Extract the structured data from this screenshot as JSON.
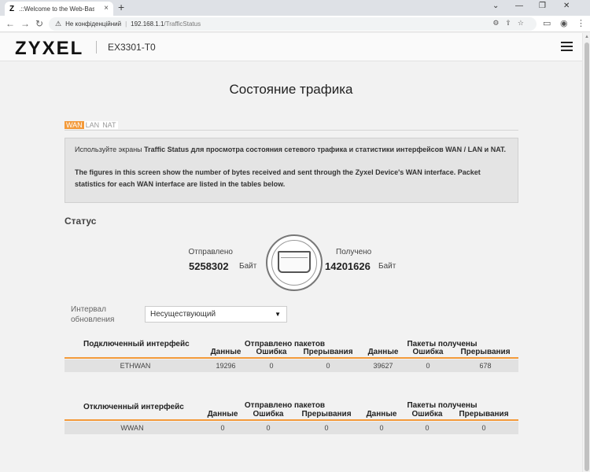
{
  "browser": {
    "tab_favicon": "Z",
    "tab_title": ".::Welcome to the Web-Based Co",
    "tab_close": "×",
    "new_tab": "+",
    "security_label": "Не конфіденційний",
    "url_host": "192.168.1.1",
    "url_path": "/TrafficStatus",
    "win_controls": [
      "⌄",
      "—",
      "❐",
      "✕"
    ]
  },
  "header": {
    "logo": "ZYXEL",
    "model": "EX3301-T0"
  },
  "page": {
    "title": "Состояние трафика",
    "tabs": [
      {
        "label": "WAN",
        "active": true
      },
      {
        "label": "LAN",
        "active": false
      },
      {
        "label": "NAT",
        "active": false
      }
    ],
    "info": {
      "line1_prefix": "Используйте экраны ",
      "line1_bold": "Traffic Status для просмотра состояния сетевого трафика и статистики интерфейсов WAN / LAN и NAT.",
      "line2": "The figures in this screen show the number of bytes received and sent through the Zyxel Device's WAN interface. Packet statistics for each WAN interface are listed in the tables below."
    },
    "status_heading": "Статус",
    "sent": {
      "label": "Отправлено",
      "value": "5258302",
      "unit": "Байт"
    },
    "received": {
      "label": "Получено",
      "value": "14201626",
      "unit": "Байт"
    },
    "interval": {
      "label": "Интервал обновления",
      "value": "Несуществующий"
    }
  },
  "tables": [
    {
      "title": "Подключенный интерфейс",
      "sent_group": "Отправлено пакетов",
      "recv_group": "Пакеты получены",
      "cols": [
        "Данные",
        "Ошибка",
        "Прерывания",
        "Данные",
        "Ошибка",
        "Прерывания"
      ],
      "row": {
        "name": "ETHWAN",
        "values": [
          "19296",
          "0",
          "0",
          "39627",
          "0",
          "678"
        ]
      }
    },
    {
      "title": "Отключенный интерфейс",
      "sent_group": "Отправлено пакетов",
      "recv_group": "Пакеты получены",
      "cols": [
        "Данные",
        "Ошибка",
        "Прерывания",
        "Данные",
        "Ошибка",
        "Прерывания"
      ],
      "row": {
        "name": "WWAN",
        "values": [
          "0",
          "0",
          "0",
          "0",
          "0",
          "0"
        ]
      }
    }
  ],
  "colors": {
    "accent": "#f39a3a",
    "info_bg": "#e4e4e4",
    "row_bg": "#e1e1e1"
  }
}
